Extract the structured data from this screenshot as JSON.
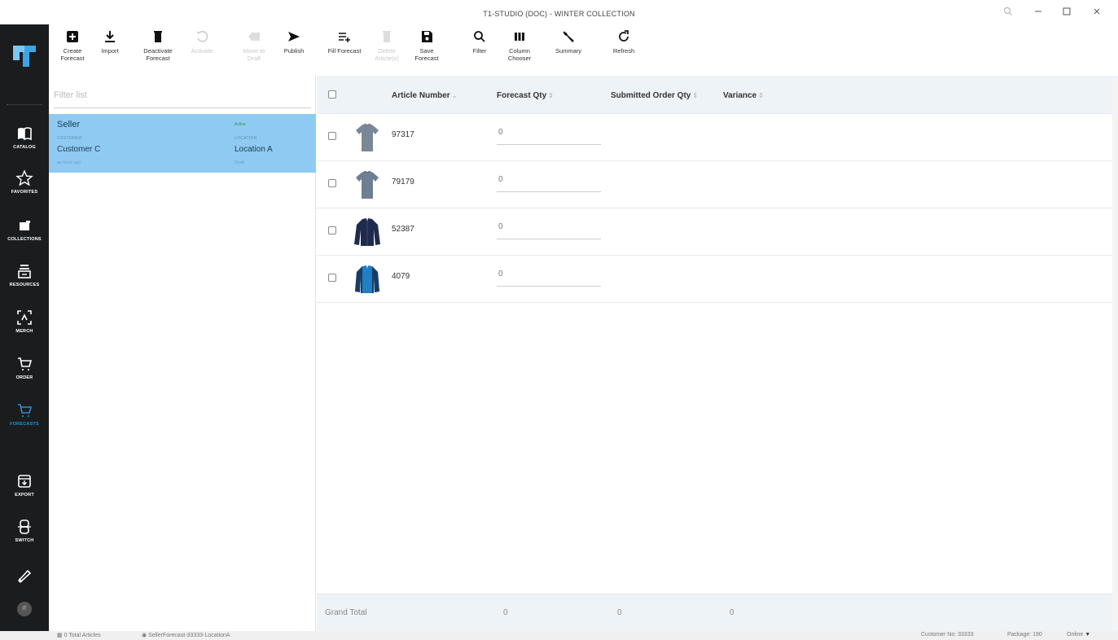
{
  "window": {
    "title": "T1-STUDIO (DOC) - WINTER COLLECTION",
    "controls": [
      "zoom-icon",
      "minimize-icon",
      "maximize-icon",
      "close-icon"
    ]
  },
  "nav": {
    "items": [
      {
        "label": "CATALOG",
        "icon": "book-icon"
      },
      {
        "label": "FAVORITES",
        "icon": "star-icon"
      },
      {
        "label": "COLLECTIONS",
        "icon": "folder-icon"
      },
      {
        "label": "RESOURCES",
        "icon": "stack-icon"
      },
      {
        "label": "MERCH",
        "icon": "scan-icon"
      },
      {
        "label": "ORDER",
        "icon": "cart-icon"
      },
      {
        "label": "FORECASTS",
        "icon": "cart-icon"
      },
      {
        "label": "EXPORT",
        "icon": "export-icon"
      },
      {
        "label": "SWITCH",
        "icon": "switch-icon"
      }
    ],
    "active": "FORECASTS",
    "accent": "#2b8fd6",
    "avatar": "IT"
  },
  "toolbar": {
    "create_forecast": [
      "Create",
      "Forecast"
    ],
    "import": "Import",
    "deactivate_forecast": [
      "Deactivate",
      "Forecast"
    ],
    "activate": "Activate",
    "move_to_draft": [
      "Move to",
      "Draft"
    ],
    "publish": "Publish",
    "fill_forecast": "Fill Forecast",
    "delete_article": [
      "Delete",
      "Article(s)"
    ],
    "save_forecast": [
      "Save",
      "Forecast"
    ],
    "filter": "Filter",
    "column_chooser": [
      "Column",
      "Chooser"
    ],
    "summary": "Summary",
    "refresh": "Refresh"
  },
  "list": {
    "filter_placeholder": "Filter list",
    "item": {
      "title": "Seller",
      "status": "Active",
      "customer_caption": "CUSTOMER",
      "customer": "Customer C",
      "location_caption": "LOCATION",
      "location": "Location A",
      "time": "an hour ago",
      "state": "Draft"
    },
    "selected_color": "#8fcaf2"
  },
  "grid": {
    "columns": {
      "article_number": "Article Number",
      "forecast_qty": "Forecast Qty",
      "submitted_order_qty": "Submitted Order Qty",
      "variance": "Variance"
    },
    "rows": [
      {
        "article": "97317",
        "qty": "0",
        "thumb": "grey-tshirt"
      },
      {
        "article": "79179",
        "qty": "0",
        "thumb": "grey-tshirt"
      },
      {
        "article": "52387",
        "qty": "0",
        "thumb": "navy-jacket"
      },
      {
        "article": "4079",
        "qty": "0",
        "thumb": "blue-jacket"
      }
    ],
    "footer": {
      "label": "Grand Total",
      "forecast_total": "0",
      "submitted_total": "0",
      "variance_total": "0"
    }
  },
  "status": {
    "articles": "0 Total Articles",
    "forecast_name": "SellerForecast-33333-LocationA",
    "customer_no": "Customer No: 33333",
    "package": "Package: 190",
    "online": "Online"
  }
}
